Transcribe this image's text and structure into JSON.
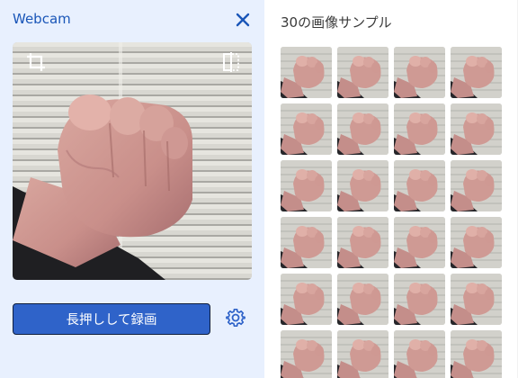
{
  "header": {
    "title": "Webcam"
  },
  "webcam": {
    "record_label": "長押しして録画"
  },
  "samples": {
    "title": "30の画像サンプル",
    "count": 30
  },
  "colors": {
    "accent": "#2f63c9",
    "panel_bg": "#e8f0fe",
    "title_blue": "#1a56b8"
  },
  "icons": {
    "close": "close-icon",
    "crop": "crop-icon",
    "flip": "flip-horizontal-icon",
    "settings": "gear-icon"
  }
}
